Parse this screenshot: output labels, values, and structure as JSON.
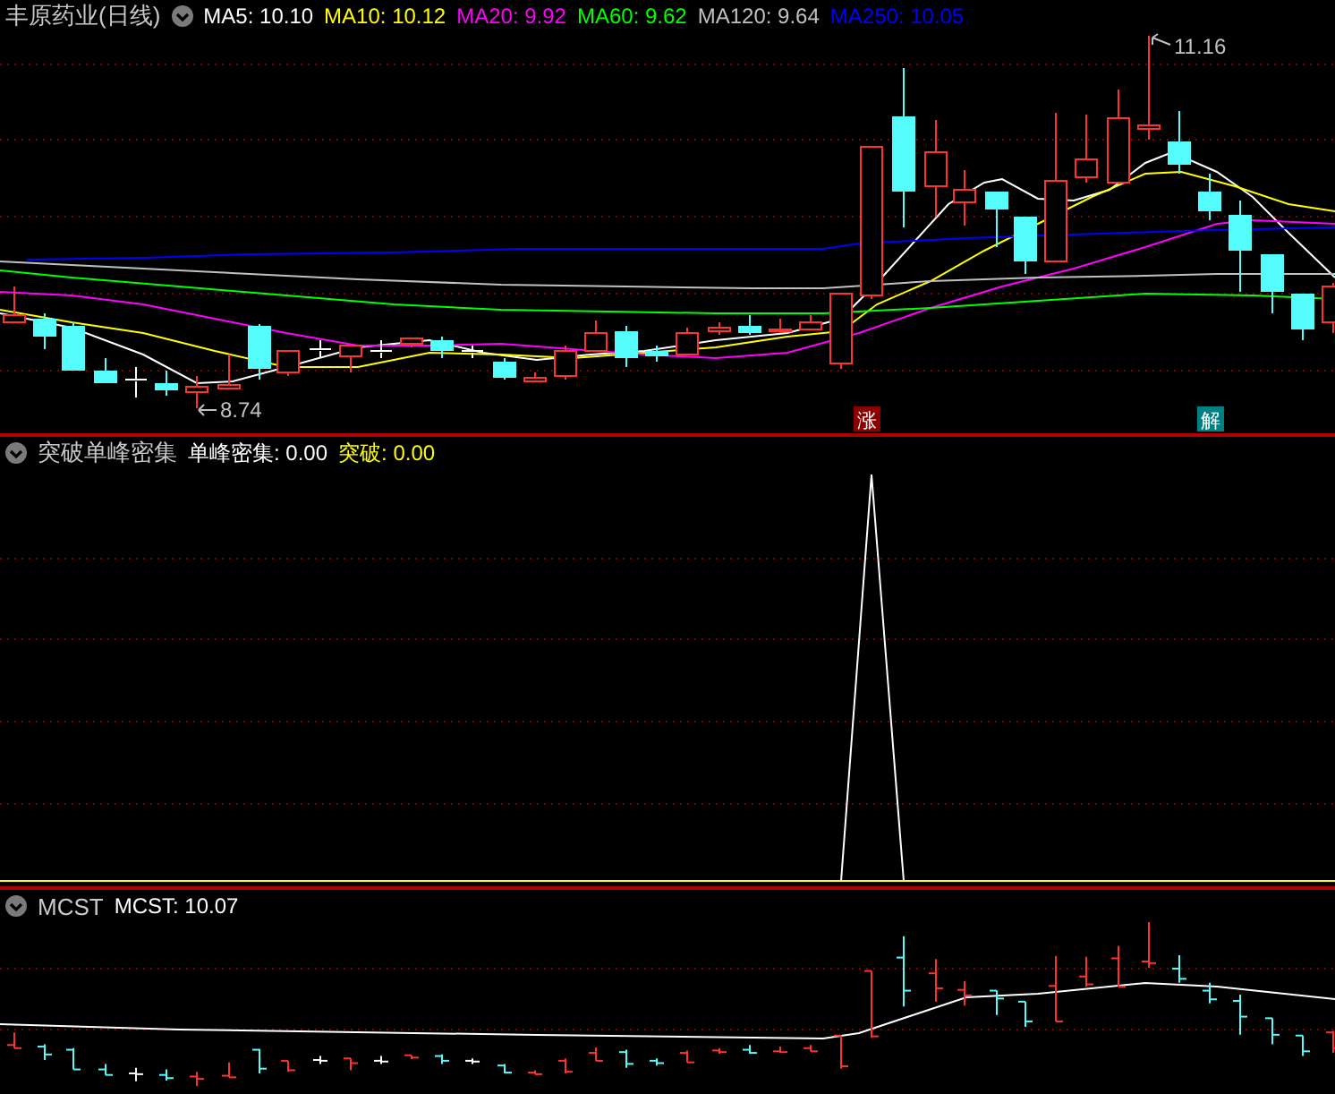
{
  "main_panel": {
    "title": "丰原药业(日线)",
    "indicators": [
      {
        "label": "MA5: 10.10",
        "color": "#ffffff"
      },
      {
        "label": "MA10: 10.12",
        "color": "#ffff00"
      },
      {
        "label": "MA20: 9.92",
        "color": "#ff00ff"
      },
      {
        "label": "MA60: 9.62",
        "color": "#00ff00"
      },
      {
        "label": "MA120: 9.64",
        "color": "#c0c0c0"
      },
      {
        "label": "MA250: 10.05",
        "color": "#0000ff"
      }
    ],
    "high_label": "11.16",
    "low_label": "8.74",
    "markers": [
      {
        "text": "涨",
        "color": "#8b0000"
      },
      {
        "text": "解",
        "color": "#008080"
      }
    ]
  },
  "indicator_panel": {
    "title": "突破单峰密集",
    "values": [
      {
        "label": "单峰密集: 0.00",
        "color": "#ffffff"
      },
      {
        "label": "突破: 0.00",
        "color": "#ffff00"
      }
    ]
  },
  "mcst_panel": {
    "title": "MCST",
    "values": [
      {
        "label": "MCST: 10.07",
        "color": "#ffffff"
      }
    ]
  }
}
